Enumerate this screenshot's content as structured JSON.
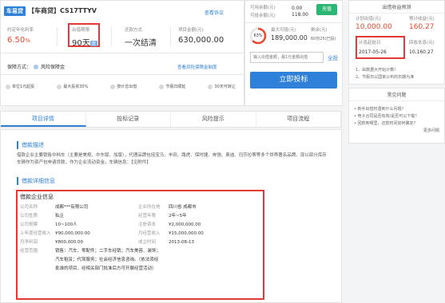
{
  "loan": {
    "tag": "车易贷",
    "title_main": "【车商贷】CS17TTYV",
    "view_agreement": "查看协议",
    "rate_label": "约定年化利率",
    "rate_value": "6.50",
    "rate_unit": "%",
    "term_label": "出借期限",
    "term_value": "90天",
    "term_badge": "送",
    "repay_label": "还款方式",
    "repay_value": "一次结清",
    "amount_label": "项目金额(元)",
    "amount_value": "630,000.00",
    "guarantee_label": "保障方式：",
    "guarantee_value": "风险保障金",
    "guarantee_link": "查看风险保障金制度",
    "features": [
      {
        "label": "单位1元起投"
      },
      {
        "label": "最大投资30%"
      },
      {
        "label": "按计息出借"
      },
      {
        "label": "节假日顺延"
      },
      {
        "label": "30天可转让"
      }
    ]
  },
  "invest": {
    "available_label": "可用余额(元)",
    "available_value": "0.00",
    "recharge_label": "充值",
    "can_invest_label": "可投余额(元)",
    "can_invest_value": "118.00",
    "progress_pct": 63,
    "progress_text": "63%",
    "max_label": "最大可投(元)",
    "max_value": "189,000.00",
    "remaining_label": "剩余(元)",
    "remaining_value": "60份25(已投)",
    "input_placeholder": "输入出借金额，最1元金额出借",
    "all_invest_label": "全投",
    "cta_label": "立即投标"
  },
  "sidebar_calc": {
    "title": "出借收益预测",
    "expected_label": "计划出借(元)",
    "expected_value": "10,000.00",
    "income_label": "预计收益(元)",
    "income_value": "160.27",
    "start_label": "计息起始日",
    "start_value": "2017-05-26",
    "end_label": "回收本息(元)",
    "end_value": "10,160.27",
    "note1": "1、由数据大开始计算！",
    "note2": "2、节假日以国家公布的日期为准"
  },
  "sidebar_faq": {
    "title": "常见问题",
    "items": [
      "新手出借时遇到什么问题？",
      "电子合同是否有效/是否可以下载？",
      "回款到哪里，还款时间如何确定？"
    ],
    "more": "更多问题"
  },
  "tabs": [
    "项目详情",
    "投标记录",
    "风险提示",
    "项目流程"
  ],
  "detail": {
    "desc_title": "借款描述",
    "desc_text": "借款企业主要销售中档车（主要是美规、中东版、加版），代理品牌包括宝马、丰田、路虎、保时捷、奔驰、奥迪、玛莎拉蒂等多个世界著名品牌。现以部分库存车辆作为资产包申请贷款，作为企业流动资金。车辆信息：【见附件】",
    "info_title": "借款详细信息",
    "company_title": "借款企业信息",
    "rows": [
      {
        "k1": "公司名称",
        "v1": "成都***有限公司",
        "k2": "企业所在地",
        "v2": "四川省 成都市"
      },
      {
        "k1": "公司性质",
        "v1": "私企",
        "k2": "经营年限",
        "v2": "2年~5年"
      },
      {
        "k1": "公司规模",
        "v1": "10~100人",
        "k2": "注册资本",
        "v2": "¥2,000,000.00"
      },
      {
        "k1": "上年度经营收入",
        "v1": "¥90,000,000.00",
        "k2": "月经营收入",
        "v2": "¥15,000,000.00"
      },
      {
        "k1": "月净利润",
        "v1": "¥800,000.00",
        "k2": "成立时间",
        "v2": "2013-08-13"
      }
    ],
    "scope_label": "经营范围",
    "scope_lines": [
      "销售：汽车、零配件；二手车经销；汽车美容、装饰；",
      "汽车租赁；代驾服务；社会经济信息咨询。（依法须经",
      "批准的项目，经相关部门批准后方可开展经营活动）"
    ]
  },
  "colors": {
    "accent": "#2e80d8",
    "red": "#e53935",
    "green": "#2bb673"
  }
}
